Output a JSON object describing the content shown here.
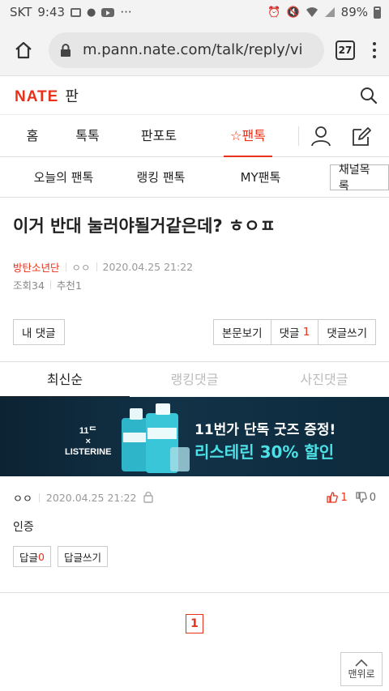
{
  "status_bar": {
    "carrier": "SKT",
    "time": "9:43",
    "more": "···",
    "battery": "89%"
  },
  "browser": {
    "url": "m.pann.nate.com/talk/reply/vi",
    "tab_count": "27"
  },
  "site": {
    "logo": "NATE",
    "section": "판"
  },
  "main_nav": [
    {
      "label": "홈"
    },
    {
      "label": "톡톡"
    },
    {
      "label": "판포토"
    },
    {
      "label": "☆팬톡",
      "active": true
    }
  ],
  "sub_nav": {
    "items": [
      {
        "label": "오늘의 팬톡"
      },
      {
        "label": "랭킹 팬톡"
      },
      {
        "label": "MY팬톡"
      }
    ],
    "channel_button": "채널목록"
  },
  "article": {
    "title": "이거 반대 눌러야될거같은데? ㅎㅇㅍ",
    "board": "방탄소년단",
    "author": "ㅇㅇ",
    "datetime": "2020.04.25 21:22",
    "views_label": "조회",
    "views": "34",
    "recommend_label": "추천",
    "recommend": "1"
  },
  "actions": {
    "my_comments": "내 댓글",
    "view_post": "본문보기",
    "comments_label": "댓글",
    "comments_count": "1",
    "write_comment": "댓글쓰기"
  },
  "comment_tabs": [
    {
      "label": "최신순",
      "active": true
    },
    {
      "label": "랭킹댓글"
    },
    {
      "label": "사진댓글"
    }
  ],
  "ad": {
    "brand_top": "11ᄃ",
    "brand_x": "×",
    "brand_bottom": "LISTERINE",
    "line1": "11번가 단독 굿즈 증정!",
    "line2": "리스테린 30% 할인"
  },
  "comments": [
    {
      "author": "ㅇㅇ",
      "datetime": "2020.04.25 21:22",
      "likes": "1",
      "dislikes": "0",
      "text": "인증",
      "reply_label": "답글",
      "reply_count": "0",
      "write_reply": "답글쓰기"
    }
  ],
  "pager": {
    "current": "1"
  },
  "to_top": "맨위로",
  "colors": {
    "accent": "#e8311a",
    "ad_bg": "#0c2333",
    "ad_highlight": "#4de0e6"
  }
}
